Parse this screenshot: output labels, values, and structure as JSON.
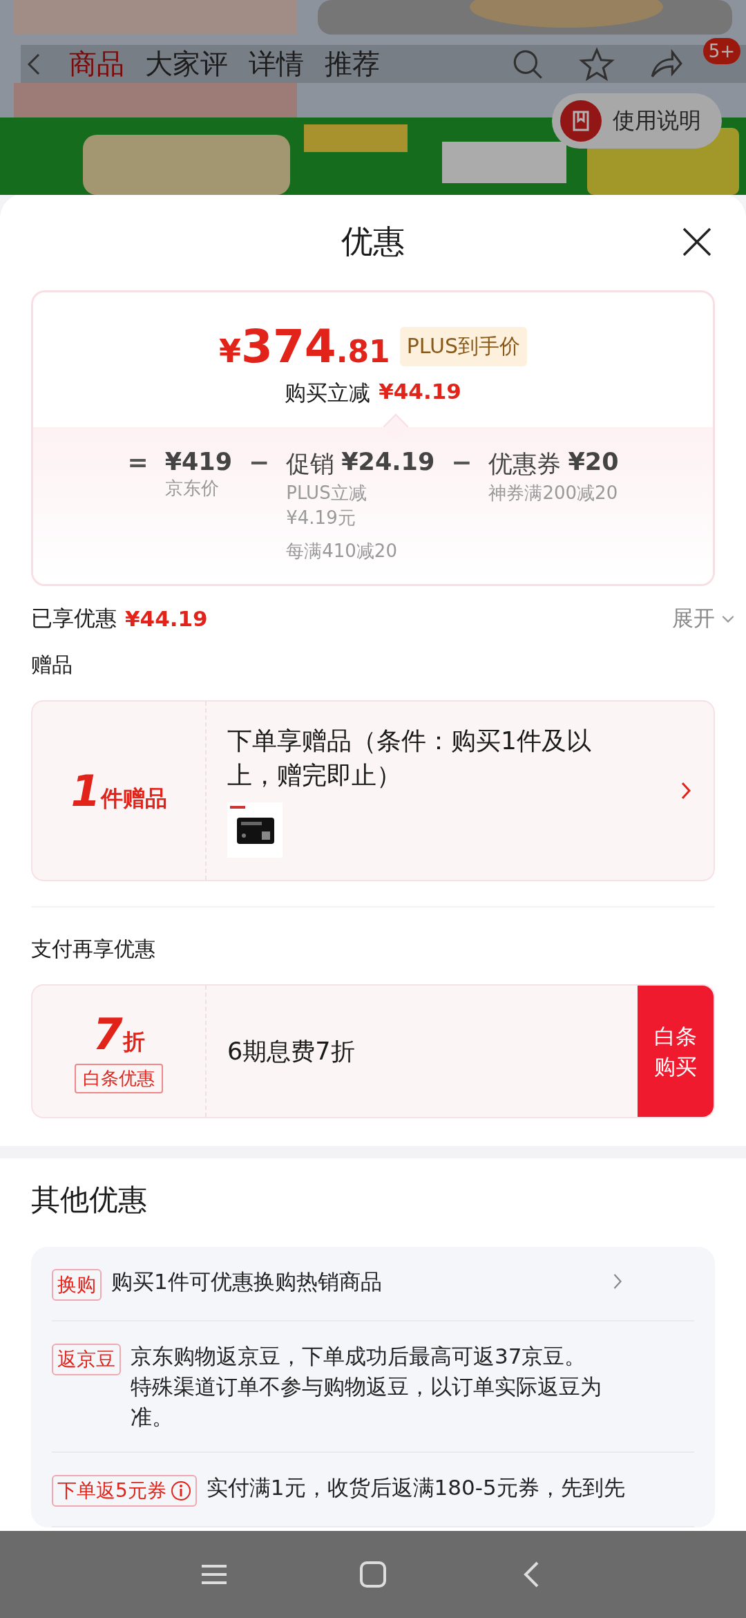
{
  "background": {
    "tabs": [
      {
        "label": "商品",
        "selected": true
      },
      {
        "label": "大家评",
        "selected": false
      },
      {
        "label": "详情",
        "selected": false
      },
      {
        "label": "推荐",
        "selected": false
      }
    ],
    "badge": "5+",
    "guide_button": "使用说明"
  },
  "sheet": {
    "title": "优惠",
    "price_card": {
      "symbol": "¥",
      "integer": "374",
      "decimal": ".81",
      "plus_tag": "PLUS到手价",
      "saving_label": "购买立减",
      "saving": "¥44.19",
      "breakdown": [
        {
          "operator": "=",
          "amount": "¥419",
          "notes": [
            "京东价"
          ]
        },
        {
          "operator": "−",
          "label": "促销",
          "amount": "¥24.19",
          "notes": [
            "PLUS立减",
            "¥4.19元"
          ],
          "extra": "每满410减20"
        },
        {
          "operator": "−",
          "label": "优惠券",
          "amount": "¥20",
          "notes": [
            "神券满200减20"
          ]
        }
      ]
    },
    "enjoyed": {
      "label": "已享优惠",
      "amount": "¥44.19",
      "expand": "展开",
      "expanded": false
    },
    "gifts": {
      "heading": "赠品",
      "count": "1",
      "unit": "件赠品",
      "text": "下单享赠品（条件：购买1件及以上，赠完即止）"
    },
    "payment": {
      "heading": "支付再享优惠",
      "discount": "7",
      "unit": "折",
      "tag": "白条优惠",
      "text": "6期息费7折",
      "button": "白条购买"
    },
    "other": {
      "heading": "其他优惠",
      "items": [
        {
          "tag": "换购",
          "lines": [
            "购买1件可优惠换购热销商品"
          ],
          "chevron": true,
          "info": false
        },
        {
          "tag": "返京豆",
          "lines": [
            "京东购物返京豆，下单成功后最高可返37京豆。",
            "特殊渠道订单不参与购物返豆，以订单实际返豆为准。"
          ],
          "chevron": false,
          "info": false
        },
        {
          "tag": "下单返5元券",
          "lines": [
            "实付满1元，收货后返满180-5元券，先到先"
          ],
          "chevron": false,
          "info": true
        }
      ]
    }
  }
}
